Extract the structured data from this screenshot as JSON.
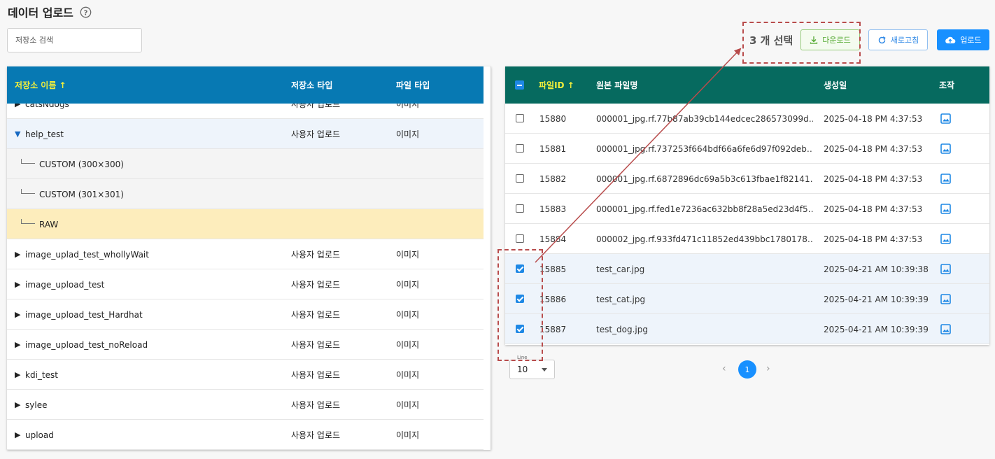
{
  "page": {
    "title": "데이터 업로드",
    "help_icon": "question-circle-icon"
  },
  "search": {
    "placeholder": "저장소 검색",
    "value": ""
  },
  "storage_table": {
    "headers": {
      "name": "저장소 이름 ↑",
      "type": "저장소 타입",
      "file_type": "파일 타입"
    },
    "rows": [
      {
        "name": "catsNdogs",
        "type": "사용자 업로드",
        "file_type": "이미지",
        "state": "collapsed",
        "partial": true
      },
      {
        "name": "help_test",
        "type": "사용자 업로드",
        "file_type": "이미지",
        "state": "expanded"
      },
      {
        "name": "CUSTOM (300×300)",
        "type": "",
        "file_type": "",
        "state": "child"
      },
      {
        "name": "CUSTOM (301×301)",
        "type": "",
        "file_type": "",
        "state": "child"
      },
      {
        "name": "RAW",
        "type": "",
        "file_type": "",
        "state": "child-selected"
      },
      {
        "name": "image_uplad_test_whollyWait",
        "type": "사용자 업로드",
        "file_type": "이미지",
        "state": "collapsed"
      },
      {
        "name": "image_upload_test",
        "type": "사용자 업로드",
        "file_type": "이미지",
        "state": "collapsed"
      },
      {
        "name": "image_upload_test_Hardhat",
        "type": "사용자 업로드",
        "file_type": "이미지",
        "state": "collapsed"
      },
      {
        "name": "image_upload_test_noReload",
        "type": "사용자 업로드",
        "file_type": "이미지",
        "state": "collapsed"
      },
      {
        "name": "kdi_test",
        "type": "사용자 업로드",
        "file_type": "이미지",
        "state": "collapsed"
      },
      {
        "name": "sylee",
        "type": "사용자 업로드",
        "file_type": "이미지",
        "state": "collapsed"
      },
      {
        "name": "upload",
        "type": "사용자 업로드",
        "file_type": "이미지",
        "state": "collapsed"
      }
    ]
  },
  "toolbar": {
    "selected_count": "3 개 선택",
    "download_label": "다운로드",
    "refresh_label": "새로고침",
    "upload_label": "업로드"
  },
  "file_table": {
    "headers": {
      "file_id": "파일ID ↑",
      "original_name": "원본 파일명",
      "created": "생성일",
      "action": "조작"
    },
    "rows": [
      {
        "id": "15880",
        "name": "000001_jpg.rf.77b87ab39cb144edcec286573099d…",
        "created": "2025-04-18 PM 4:37:53",
        "checked": false
      },
      {
        "id": "15881",
        "name": "000001_jpg.rf.737253f664bdf66a6fe6d97f092deb…",
        "created": "2025-04-18 PM 4:37:53",
        "checked": false
      },
      {
        "id": "15882",
        "name": "000001_jpg.rf.6872896dc69a5b3c613fbae1f82141…",
        "created": "2025-04-18 PM 4:37:53",
        "checked": false
      },
      {
        "id": "15883",
        "name": "000001_jpg.rf.fed1e7236ac632bb8f28a5ed23d4f5…",
        "created": "2025-04-18 PM 4:37:53",
        "checked": false
      },
      {
        "id": "15884",
        "name": "000002_jpg.rf.933fd471c11852ed439bbc1780178…",
        "created": "2025-04-18 PM 4:37:53",
        "checked": false
      },
      {
        "id": "15885",
        "name": "test_car.jpg",
        "created": "2025-04-21 AM 10:39:38",
        "checked": true
      },
      {
        "id": "15886",
        "name": "test_cat.jpg",
        "created": "2025-04-21 AM 10:39:39",
        "checked": true
      },
      {
        "id": "15887",
        "name": "test_dog.jpg",
        "created": "2025-04-21 AM 10:39:39",
        "checked": true
      }
    ]
  },
  "pagination": {
    "line_label": "Line",
    "line_value": "10",
    "current_page": "1",
    "prev": "‹",
    "next": "›"
  },
  "colors": {
    "left_header": "#0779b3",
    "right_header": "#066a5f",
    "sorted_header_text": "#f2ef3b",
    "primary": "#1890ff",
    "annotation": "#b84c4c"
  }
}
